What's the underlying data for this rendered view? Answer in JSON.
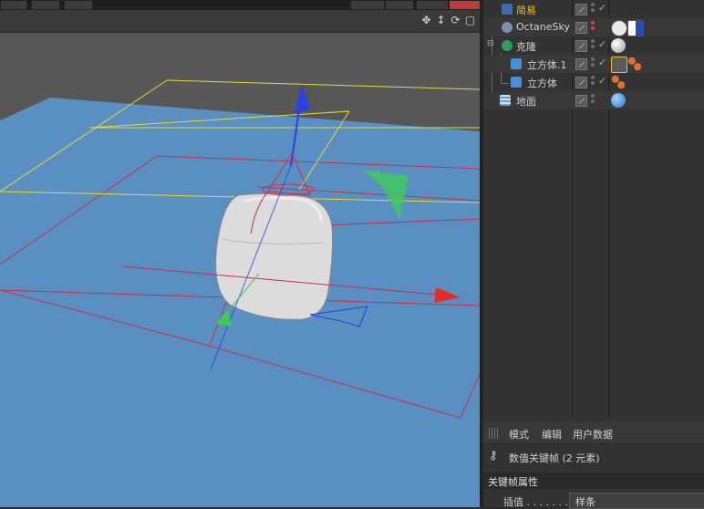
{
  "viewport": {
    "nav_icons": [
      "move-icon",
      "dolly-icon",
      "rotate-icon",
      "maximize-icon"
    ]
  },
  "object_manager": {
    "items": [
      {
        "label": "简易",
        "icon": "camera-icon",
        "highlight": true
      },
      {
        "label": "OctaneSky",
        "icon": "sky-icon",
        "highlight": false
      },
      {
        "label": "克隆",
        "icon": "cloner-icon",
        "highlight": false
      },
      {
        "label": "立方体.1",
        "icon": "cube-icon",
        "highlight": false
      },
      {
        "label": "立方体",
        "icon": "cube-icon",
        "highlight": false
      },
      {
        "label": "地面",
        "icon": "floor-icon",
        "highlight": false
      }
    ]
  },
  "attribute_manager": {
    "tabs": [
      "模式",
      "编辑",
      "用户数据"
    ],
    "title": "数值关键帧 (2 元素)",
    "section": "关键帧属性",
    "field_label": "插值 . . . . . . .",
    "field_value": "样条"
  },
  "colors": {
    "floor": "#5a8fc2",
    "background": "#575757",
    "axis_x": "#e52a2a",
    "axis_y": "#3ec95a",
    "axis_z": "#2b3fe6",
    "bbox": "#e8d83a",
    "highlight_text": "#f0c000"
  }
}
